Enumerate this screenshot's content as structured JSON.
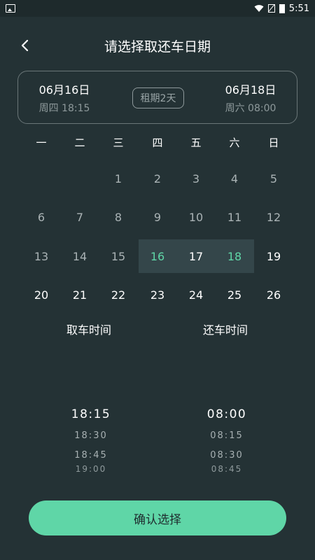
{
  "status_bar": {
    "time": "5:51"
  },
  "header": {
    "title": "请选择取还车日期"
  },
  "range_summary": {
    "pickup": {
      "date": "06月16日",
      "detail": "周四 18:15"
    },
    "return": {
      "date": "06月18日",
      "detail": "周六 08:00"
    },
    "duration": "租期2天"
  },
  "calendar": {
    "weekdays": [
      "一",
      "二",
      "三",
      "四",
      "五",
      "六",
      "日"
    ],
    "rows": [
      [
        "",
        "",
        "1",
        "2",
        "3",
        "4",
        "5"
      ],
      [
        "6",
        "7",
        "8",
        "9",
        "10",
        "11",
        "12"
      ],
      [
        "13",
        "14",
        "15",
        "16",
        "17",
        "18",
        "19"
      ],
      [
        "20",
        "21",
        "22",
        "23",
        "24",
        "25",
        "26"
      ]
    ],
    "start_day": "16",
    "end_day": "18",
    "first_selectable_day": "16"
  },
  "time_pickers": {
    "pickup": {
      "label": "取车时间",
      "selected": "18:15",
      "options": [
        "18:30",
        "18:45",
        "19:00"
      ]
    },
    "return": {
      "label": "还车时间",
      "selected": "08:00",
      "options": [
        "08:15",
        "08:30",
        "08:45"
      ]
    }
  },
  "colors": {
    "accent": "#5fd6a7",
    "background": "#243235",
    "range_highlight": "#34464a"
  },
  "confirm_button": {
    "label": "确认选择"
  }
}
